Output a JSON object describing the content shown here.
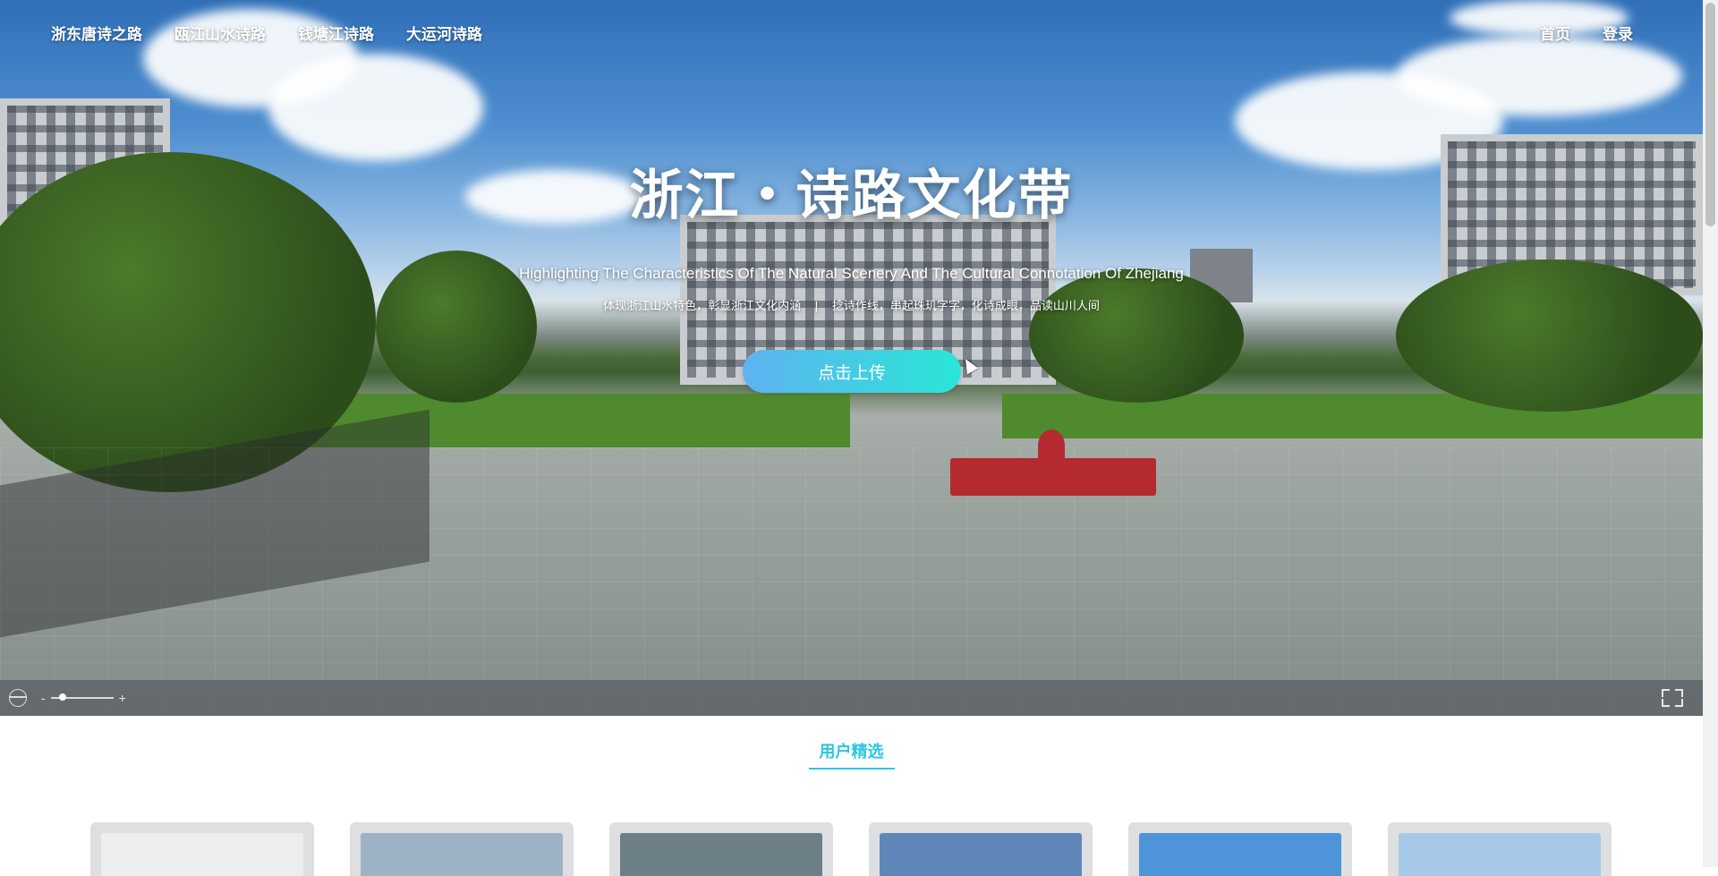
{
  "nav": {
    "left": [
      "浙东唐诗之路",
      "瓯江山水诗路",
      "钱塘江诗路",
      "大运河诗路"
    ],
    "right": [
      "首页",
      "登录"
    ]
  },
  "hero": {
    "title": "浙江・诗路文化带",
    "subtitle": "Highlighting The Characteristics Of The Natural Scenery And The Cultural Connotation Of Zhejiang",
    "tagline_left": "体现浙江山水特色，彰显浙江文化内涵",
    "tagline_sep": "|",
    "tagline_right": "捻诗作线，串起珠玑字字，化诗成眼，品读山川人间",
    "upload_button": "点击上传"
  },
  "viewer": {
    "zoom_out": "-",
    "zoom_in": "+",
    "zoom_level": 0.15
  },
  "section": {
    "title": "用户精选"
  },
  "cards": [
    {
      "thumb_color": "#eceef0"
    },
    {
      "thumb_color": "#9db2c4"
    },
    {
      "thumb_color": "#6c7f86"
    },
    {
      "thumb_color": "#5f86b8"
    },
    {
      "thumb_color": "#4e94d8"
    },
    {
      "thumb_color": "#a7c9e8"
    }
  ],
  "colors": {
    "accent": "#2cc6e0",
    "button_start": "#5fb2f2",
    "button_end": "#29e6d6"
  }
}
